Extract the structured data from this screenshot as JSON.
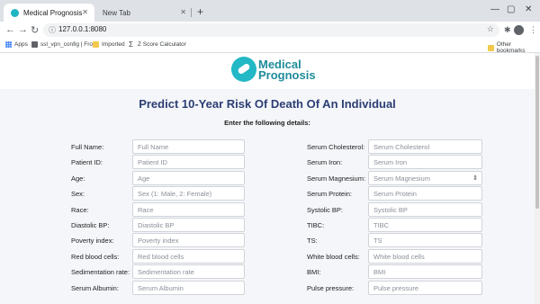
{
  "browser": {
    "tabs": [
      {
        "title": "Medical Prognosis"
      },
      {
        "title": "New Tab"
      }
    ],
    "url": "127.0.0.1:8080",
    "bookmarks": [
      "Apps",
      "ssl_vpn_config | Fro...",
      "Imported",
      "Z Score Calculator"
    ],
    "other_bookmarks": "Other bookmarks"
  },
  "logo": {
    "line1": "Medical",
    "line2": "Prognosis"
  },
  "page": {
    "title": "Predict 10-Year Risk Of Death Of An Individual",
    "subtitle": "Enter the following details:"
  },
  "form": {
    "left": [
      {
        "label": "Full Name:",
        "placeholder": "Full Name"
      },
      {
        "label": "Patient ID:",
        "placeholder": "Patient ID"
      },
      {
        "label": "Age:",
        "placeholder": "Age"
      },
      {
        "label": "Sex:",
        "placeholder": "Sex (1: Male, 2: Female)"
      },
      {
        "label": "Race:",
        "placeholder": "Race"
      },
      {
        "label": "Diastolic BP:",
        "placeholder": "Diastolic BP"
      },
      {
        "label": "Poverty index:",
        "placeholder": "Poverty index"
      },
      {
        "label": "Red blood cells:",
        "placeholder": "Red blood cells"
      },
      {
        "label": "Sedimentation rate:",
        "placeholder": "Sedimentation rate"
      },
      {
        "label": "Serum Albumin:",
        "placeholder": "Serum Albumin"
      }
    ],
    "right": [
      {
        "label": "Serum Cholesterol:",
        "placeholder": "Serum Cholesterol"
      },
      {
        "label": "Serum Iron:",
        "placeholder": "Serum Iron"
      },
      {
        "label": "Serum Magnesium:",
        "placeholder": "Serum Magnesium"
      },
      {
        "label": "Serum Protein:",
        "placeholder": "Serum Protein"
      },
      {
        "label": "Systolic BP:",
        "placeholder": "Systolic BP"
      },
      {
        "label": "TIBC:",
        "placeholder": "TIBC"
      },
      {
        "label": "TS:",
        "placeholder": "TS"
      },
      {
        "label": "White blood cells:",
        "placeholder": "White blood cells"
      },
      {
        "label": "BMI:",
        "placeholder": "BMI"
      },
      {
        "label": "Pulse pressure:",
        "placeholder": "Pulse pressure"
      }
    ]
  },
  "colors": {
    "accent": "#22b8c6",
    "title": "#2c3e73"
  }
}
